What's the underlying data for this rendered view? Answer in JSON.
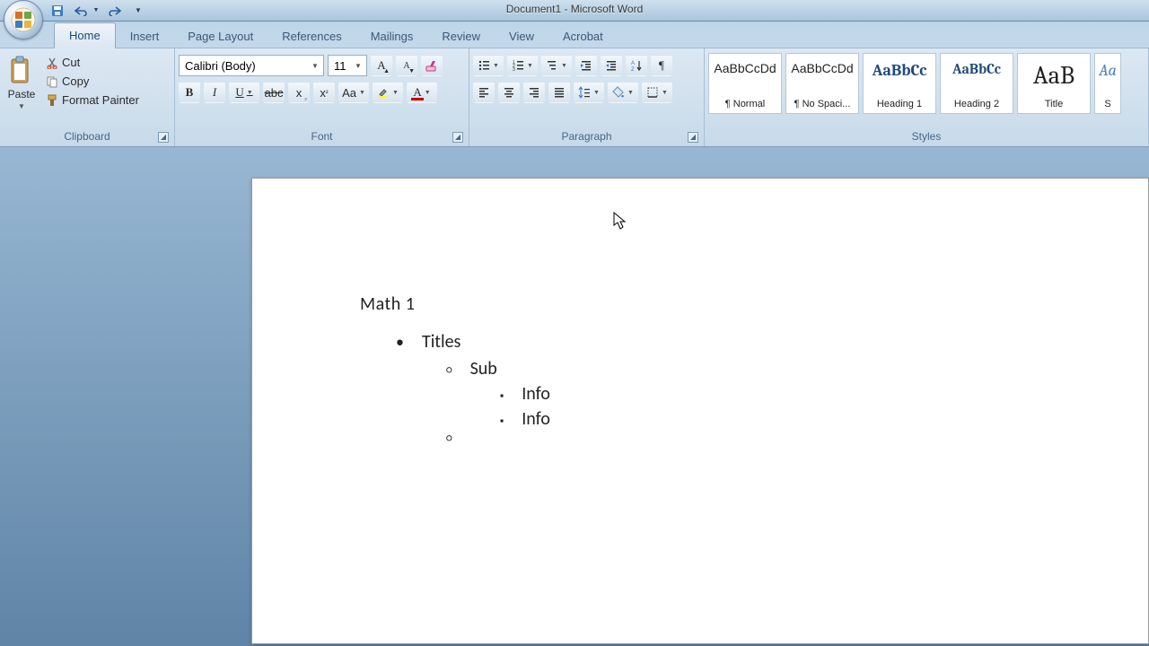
{
  "title": "Document1 - Microsoft Word",
  "tabs": {
    "home": "Home",
    "insert": "Insert",
    "pageLayout": "Page Layout",
    "references": "References",
    "mailings": "Mailings",
    "review": "Review",
    "view": "View",
    "acrobat": "Acrobat"
  },
  "clipboard": {
    "paste": "Paste",
    "cut": "Cut",
    "copy": "Copy",
    "formatPainter": "Format Painter",
    "groupLabel": "Clipboard"
  },
  "font": {
    "name": "Calibri (Body)",
    "size": "11",
    "groupLabel": "Font"
  },
  "paragraph": {
    "groupLabel": "Paragraph"
  },
  "styles": {
    "sample": "AaBbCcDd",
    "sampleHeading": "AaBbCc",
    "sampleTitle": "AaB",
    "sampleSub": "Aa",
    "normal": "¶ Normal",
    "noSpacing": "¶ No Spaci...",
    "heading1": "Heading 1",
    "heading2": "Heading 2",
    "title": "Title",
    "subtitle": "S",
    "groupLabel": "Styles"
  },
  "document": {
    "heading": "Math 1",
    "l1a": "Titles",
    "l2a": "Sub",
    "l3a": "Info",
    "l3b": "Info",
    "l2b": ""
  },
  "colors": {
    "highlight": "#ffff00",
    "fontColor": "#c00000",
    "accent": "#3a7ac0"
  }
}
